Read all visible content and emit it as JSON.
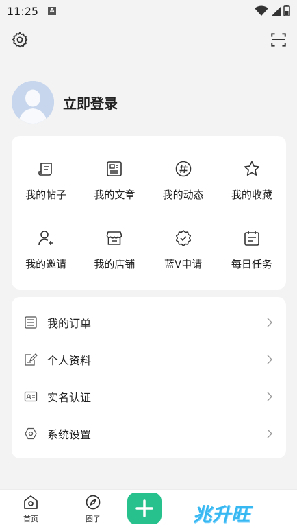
{
  "status_bar": {
    "time": "11:25",
    "notification_badge": "A"
  },
  "profile": {
    "login_label": "立即登录"
  },
  "grid_items": [
    {
      "label": "我的帖子",
      "icon": "post-icon"
    },
    {
      "label": "我的文章",
      "icon": "article-icon"
    },
    {
      "label": "我的动态",
      "icon": "hashtag-icon"
    },
    {
      "label": "我的收藏",
      "icon": "star-icon"
    },
    {
      "label": "我的邀请",
      "icon": "invite-user-icon"
    },
    {
      "label": "我的店铺",
      "icon": "store-icon"
    },
    {
      "label": "蓝V申请",
      "icon": "verified-badge-icon"
    },
    {
      "label": "每日任务",
      "icon": "calendar-icon"
    }
  ],
  "menu_items": [
    {
      "label": "我的订单",
      "icon": "order-icon"
    },
    {
      "label": "个人资料",
      "icon": "edit-profile-icon"
    },
    {
      "label": "实名认证",
      "icon": "id-card-icon"
    },
    {
      "label": "系统设置",
      "icon": "settings-hex-icon"
    }
  ],
  "bottom_nav": {
    "home_label": "首页",
    "circle_label": "圈子",
    "watermark": "兆升旺"
  },
  "colors": {
    "accent": "#27c18e",
    "watermark": "#38b8f0"
  }
}
